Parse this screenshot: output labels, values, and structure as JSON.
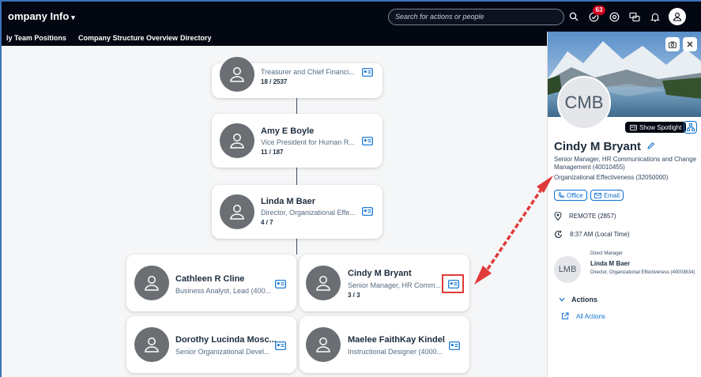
{
  "topbar": {
    "app_title": "ompany Info",
    "search_placeholder": "Search for actions or people",
    "notification_count": "63"
  },
  "subnav": {
    "items": [
      "ly Team Positions",
      "Company Structure Overview",
      "Directory"
    ]
  },
  "chart": {
    "top_card": {
      "title": "Treasurer and Chief Financi...",
      "count": "18 / 2537"
    },
    "cards": [
      {
        "name": "Amy E Boyle",
        "title": "Vice President for Human R...",
        "count": "11 / 187"
      },
      {
        "name": "Linda M Baer",
        "title": "Director, Organizational Effe...",
        "count": "4 / 7"
      },
      {
        "name": "Cathleen R Cline",
        "title": "Business Analyst, Lead (400...",
        "count": ""
      },
      {
        "name": "Cindy M Bryant",
        "title": "Senior Manager, HR Comm...",
        "count": "3 / 3"
      },
      {
        "name": "Dorothy Lucinda Mosc...",
        "title": "Senior Organizational Devel...",
        "count": ""
      },
      {
        "name": "Maelee FaithKay Kindel",
        "title": "Instructional Designer (4000...",
        "count": ""
      }
    ]
  },
  "panel": {
    "initials": "CMB",
    "spotlight_label": "Show Spotlight",
    "name": "Cindy M Bryant",
    "position": "Senior Manager, HR Communications and Change Management (40010455)",
    "department": "Organizational Effectiveness (32050000)",
    "office_label": "Office",
    "email_label": "Email",
    "location": "REMOTE (2857)",
    "local_time": "8:37 AM (Local Time)",
    "manager": {
      "heading": "Direct Manager",
      "initials": "LMB",
      "name": "Linda M Baer",
      "title": "Director, Organizational Effectiveness (40003834)"
    },
    "actions_label": "Actions",
    "all_actions_label": "All Actions"
  },
  "colors": {
    "topbar": "#030712",
    "accent": "#0a6ed1",
    "highlight": "#e03a3a",
    "badge": "#d0001e"
  }
}
